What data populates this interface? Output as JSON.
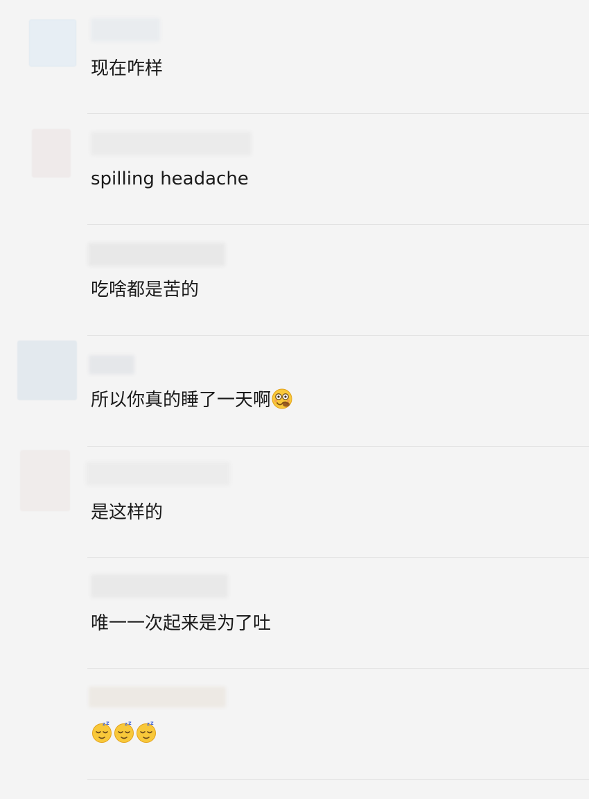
{
  "messages": [
    {
      "text": "现在咋样",
      "emojis": []
    },
    {
      "text": "spilling headache",
      "emojis": []
    },
    {
      "text": "吃啥都是苦的",
      "emojis": []
    },
    {
      "text": "所以你真的睡了一天啊",
      "emojis": [
        "woozy-face-icon"
      ]
    },
    {
      "text": "是这样的",
      "emojis": []
    },
    {
      "text": "唯一一次起来是为了吐",
      "emojis": []
    },
    {
      "text": "",
      "emojis": [
        "sleeping-face-icon",
        "sleeping-face-icon",
        "sleeping-face-icon"
      ]
    }
  ],
  "colors": {
    "background": "#f4f4f4",
    "divider": "#e1e1e1",
    "text": "#1a1a1a"
  }
}
